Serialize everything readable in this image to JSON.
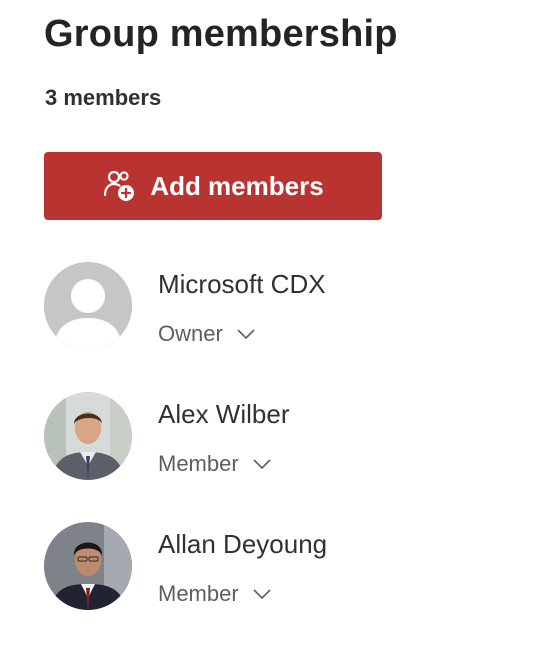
{
  "header": {
    "title": "Group membership",
    "member_count": "3 members"
  },
  "add_button": {
    "label": "Add members",
    "icon": "add-people-icon",
    "color": "#b93431"
  },
  "members": [
    {
      "name": "Microsoft CDX",
      "role": "Owner",
      "avatar": "default-person-icon"
    },
    {
      "name": "Alex Wilber",
      "role": "Member",
      "avatar": "photo"
    },
    {
      "name": "Allan Deyoung",
      "role": "Member",
      "avatar": "photo"
    }
  ]
}
